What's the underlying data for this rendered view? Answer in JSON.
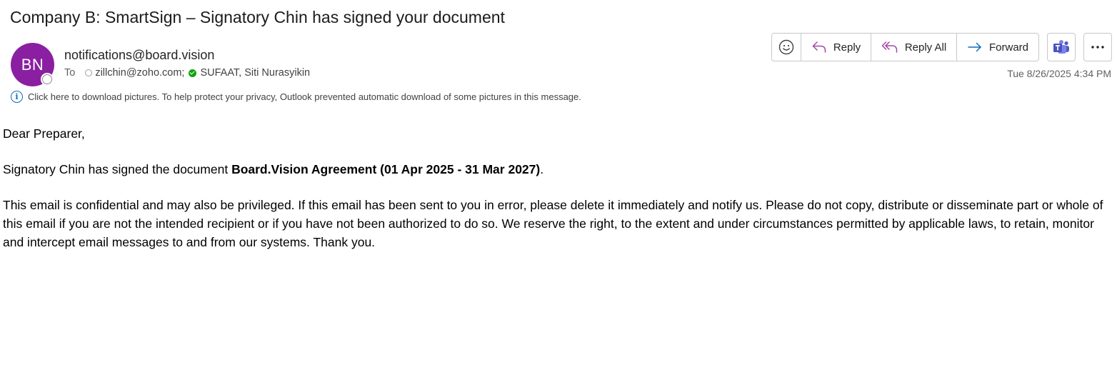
{
  "email": {
    "subject": "Company B: SmartSign – Signatory Chin has signed your document",
    "avatar_initials": "BN",
    "avatar_color": "#8b1fa2",
    "sender": "notifications@board.vision",
    "to_label": "To",
    "recipients": [
      {
        "name": "zillchin@zoho.com;",
        "status": "unknown"
      },
      {
        "name": "SUFAAT, Siti Nurasyikin",
        "status": "available"
      }
    ],
    "info_bar": "Click here to download pictures. To help protect your privacy, Outlook prevented automatic download of some pictures in this message.",
    "timestamp": "Tue 8/26/2025 4:34 PM"
  },
  "toolbar": {
    "emoji_icon": "smiley-icon",
    "reply_label": "Reply",
    "reply_all_label": "Reply All",
    "forward_label": "Forward",
    "teams_icon": "teams-icon",
    "more_icon": "more-icon"
  },
  "body": {
    "greeting": "Dear Preparer,",
    "line_prefix": "Signatory Chin has signed the document ",
    "document_name": "Board.Vision Agreement (01 Apr 2025 - 31 Mar 2027)",
    "line_suffix": ".",
    "disclaimer": "This email is confidential and may also be privileged. If this email has been sent to you in error, please delete it immediately and notify us. Please do not copy, distribute or disseminate part or whole of this email if you are not the intended recipient or if you have not been authorized to do so. We reserve the right, to the extent and under circumstances permitted by applicable laws, to retain, monitor and intercept email messages to and from our systems. Thank you."
  },
  "colors": {
    "accent": "#0f6cbd",
    "reply_all_purple": "#a745a7",
    "teams_purple": "#5059c9",
    "available_green": "#13a10e"
  }
}
